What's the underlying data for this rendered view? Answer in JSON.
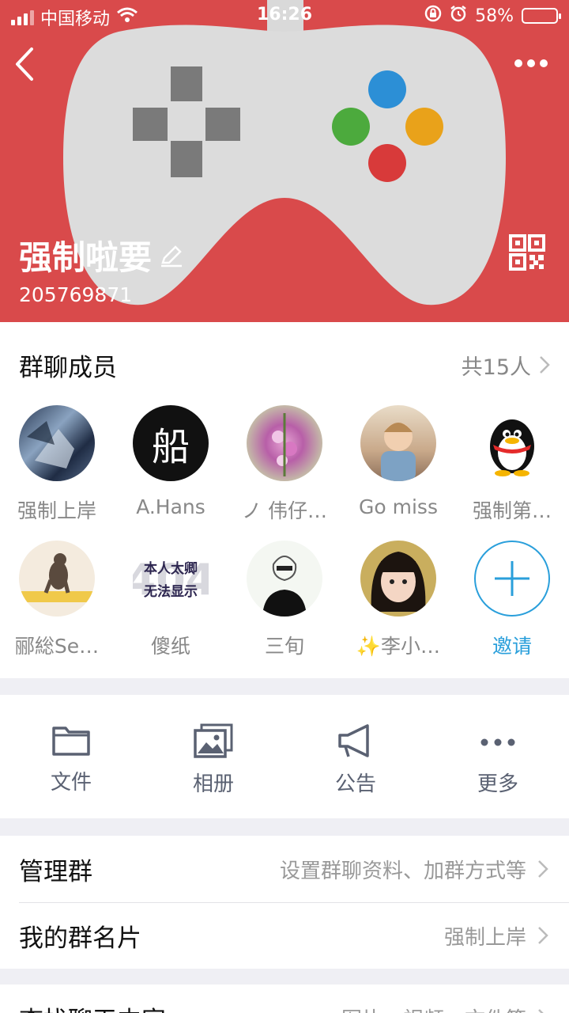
{
  "status_bar": {
    "carrier": "中国移动",
    "time": "16:26",
    "battery_percent": "58%",
    "battery_level": 0.58
  },
  "group": {
    "name": "强制啦要",
    "id": "205769871"
  },
  "members": {
    "title": "群聊成员",
    "count": "共15人",
    "list": [
      {
        "name": "强制上岸"
      },
      {
        "name": "A.Hans"
      },
      {
        "name": "ノ 伟仔…"
      },
      {
        "name": "Go miss"
      },
      {
        "name": "强制第…"
      },
      {
        "name": "郦総Se…"
      },
      {
        "name": "傻纸"
      },
      {
        "name": "三旬"
      },
      {
        "name": "✨李小…"
      }
    ],
    "invite_label": "邀请",
    "avatar_texts": {
      "hans": "船",
      "placeholder_line1": "本人太卿",
      "placeholder_line2": "无法显示",
      "placeholder_bg": "404"
    }
  },
  "toolbar": {
    "files": "文件",
    "album": "相册",
    "announce": "公告",
    "more": "更多"
  },
  "list": {
    "manage_title": "管理群",
    "manage_value": "设置群聊资料、加群方式等",
    "card_title": "我的群名片",
    "card_value": "强制上岸",
    "search_title": "查找聊天内容",
    "search_value": "图片、视频、文件等"
  },
  "colors": {
    "header": "#d94a4b",
    "accent": "#2a9fdb"
  }
}
